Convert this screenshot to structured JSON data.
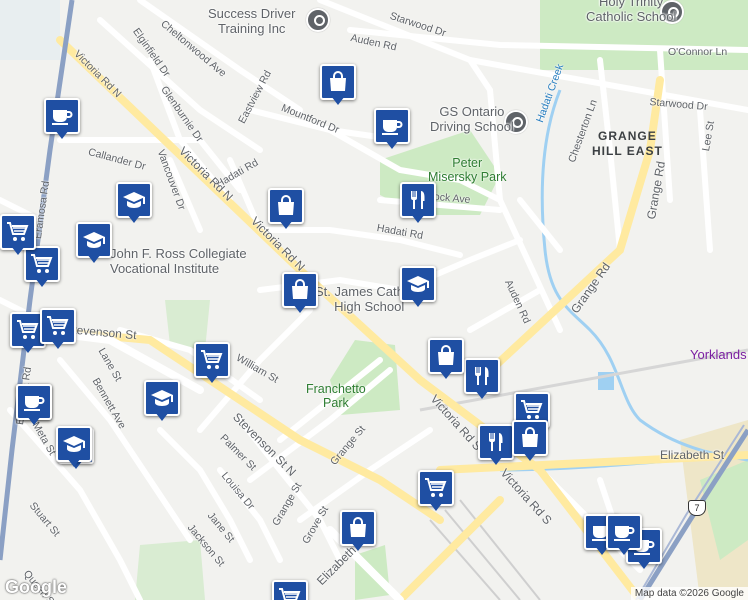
{
  "map": {
    "streets": [
      "Starwood Dr",
      "Auden Rd",
      "Cheltonwood Ave",
      "Elginfield Dr",
      "Glenburnie Dr",
      "Eastview Rd",
      "Mountford Dr",
      "Callander Dr",
      "Vancouver Dr",
      "Hadati Rd",
      "Victoria Rd N",
      "Eramosa Rd",
      "Stevenson St N",
      "Lane St",
      "Bennett Ave",
      "William St",
      "Palmer St",
      "Louisa Dr",
      "Grange St",
      "Grove St",
      "Jane St",
      "Jackson St",
      "Stuart St",
      "Elizabeth St",
      "Victoria Rd S",
      "Grange Rd",
      "Chesterton Ln",
      "Lee St",
      "O'Connor Ln",
      "Brock Ave",
      "Meta St",
      "Hadati Creek",
      "Queen St",
      "Stevenson St"
    ],
    "places": {
      "success_driver": "Success Driver\nTraining Inc",
      "holy_trinity": "Holy Trinity\nCatholic School",
      "gs_ontario": "GS Ontario\nDriving School",
      "peter_misersky": "Peter\nMisersky Park",
      "grange_hill_east": "GRANGE\nHILL EAST",
      "john_ross": "John F. Ross Collegiate\nVocational Institute",
      "st_james": "St. James Catholic\nHigh School",
      "franchetto": "Franchetto\nPark",
      "yorklands": "Yorklands"
    },
    "highway_shield": "7",
    "colors": {
      "marker": "#1f4fa3",
      "park": "#cdeac3",
      "water": "#9fd0f2",
      "road": "#ffffff",
      "arterial": "#ffeaa0",
      "highway": "#8ba0c4"
    }
  },
  "markers": [
    {
      "icon": "cafe-icon"
    },
    {
      "icon": "shopping-bag-icon"
    },
    {
      "icon": "cafe-icon"
    },
    {
      "icon": "shopping-bag-icon"
    },
    {
      "icon": "restaurant-icon"
    },
    {
      "icon": "school-icon"
    },
    {
      "icon": "school-icon"
    },
    {
      "icon": "shopping-cart-icon"
    },
    {
      "icon": "shopping-cart-icon"
    },
    {
      "icon": "cafe-icon"
    },
    {
      "icon": "shopping-bag-icon"
    },
    {
      "icon": "school-icon"
    },
    {
      "icon": "shopping-cart-icon"
    },
    {
      "icon": "shopping-cart-icon"
    },
    {
      "icon": "school-icon"
    },
    {
      "icon": "cafe-icon"
    },
    {
      "icon": "school-icon"
    },
    {
      "icon": "shopping-bag-icon"
    },
    {
      "icon": "restaurant-icon"
    },
    {
      "icon": "shopping-cart-icon"
    },
    {
      "icon": "shopping-bag-icon"
    },
    {
      "icon": "restaurant-icon"
    },
    {
      "icon": "shopping-cart-icon"
    },
    {
      "icon": "shopping-bag-icon"
    },
    {
      "icon": "cafe-icon"
    },
    {
      "icon": "cafe-icon"
    },
    {
      "icon": "shopping-cart-icon"
    },
    {
      "icon": "shopping-cart-icon"
    },
    {
      "icon": "cafe-icon"
    },
    {
      "icon": "school-icon"
    }
  ],
  "footer": {
    "copyright": "Map data ©2026 Google",
    "logo": "Google"
  }
}
